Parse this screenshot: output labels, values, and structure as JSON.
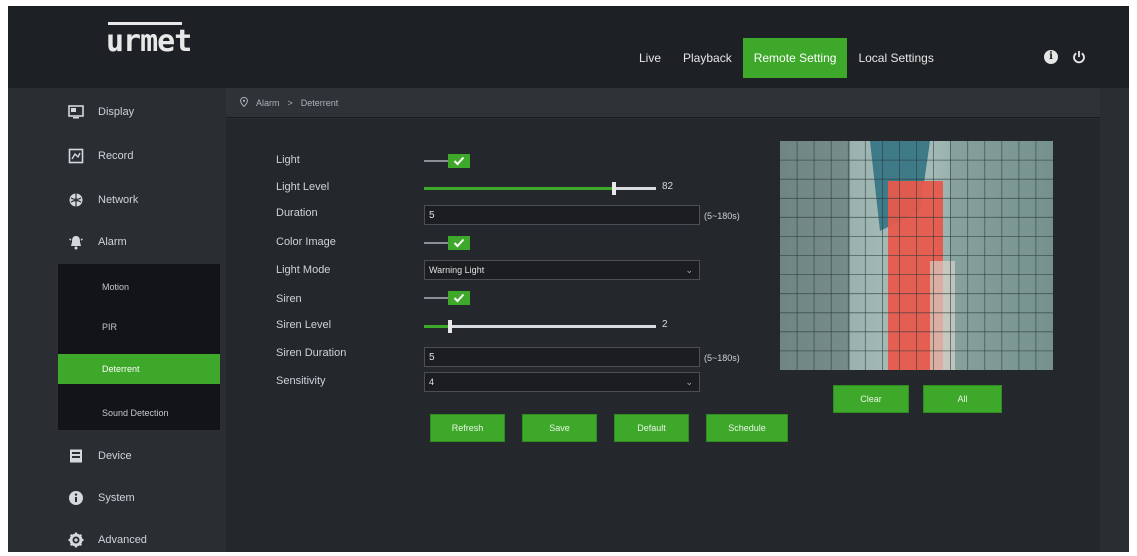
{
  "brand": {
    "logo": "urmet"
  },
  "topnav": {
    "items": [
      "Live",
      "Playback",
      "Remote Setting",
      "Local Settings"
    ],
    "active_index": 2
  },
  "sidebar": {
    "items": [
      "Display",
      "Record",
      "Network",
      "Alarm",
      "Device",
      "System",
      "Advanced"
    ],
    "alarm_sub": [
      "Motion",
      "PIR",
      "Deterrent",
      "Sound Detection"
    ],
    "active_sub_index": 2
  },
  "breadcrumb": [
    "Alarm",
    "Deterrent"
  ],
  "form": {
    "light": {
      "label": "Light",
      "checked": true
    },
    "light_level": {
      "label": "Light Level",
      "value": 82,
      "min": 0,
      "max": 100
    },
    "duration": {
      "label": "Duration",
      "value": "5",
      "hint": "(5~180s)"
    },
    "color_image": {
      "label": "Color Image",
      "checked": true
    },
    "light_mode": {
      "label": "Light Mode",
      "value": "Warning Light"
    },
    "siren": {
      "label": "Siren",
      "checked": true
    },
    "siren_level": {
      "label": "Siren Level",
      "value": 2,
      "min": 1,
      "max": 10
    },
    "siren_duration": {
      "label": "Siren Duration",
      "value": "5",
      "hint": "(5~180s)"
    },
    "sensitivity": {
      "label": "Sensitivity",
      "value": "4"
    }
  },
  "buttons": {
    "refresh": "Refresh",
    "save": "Save",
    "default": "Default",
    "schedule": "Schedule"
  },
  "preview": {
    "clear": "Clear",
    "all": "All"
  },
  "colors": {
    "accent": "#3ea82a",
    "background": "#2a2e33",
    "topbar": "#1d2024",
    "panel": "#24272b"
  }
}
